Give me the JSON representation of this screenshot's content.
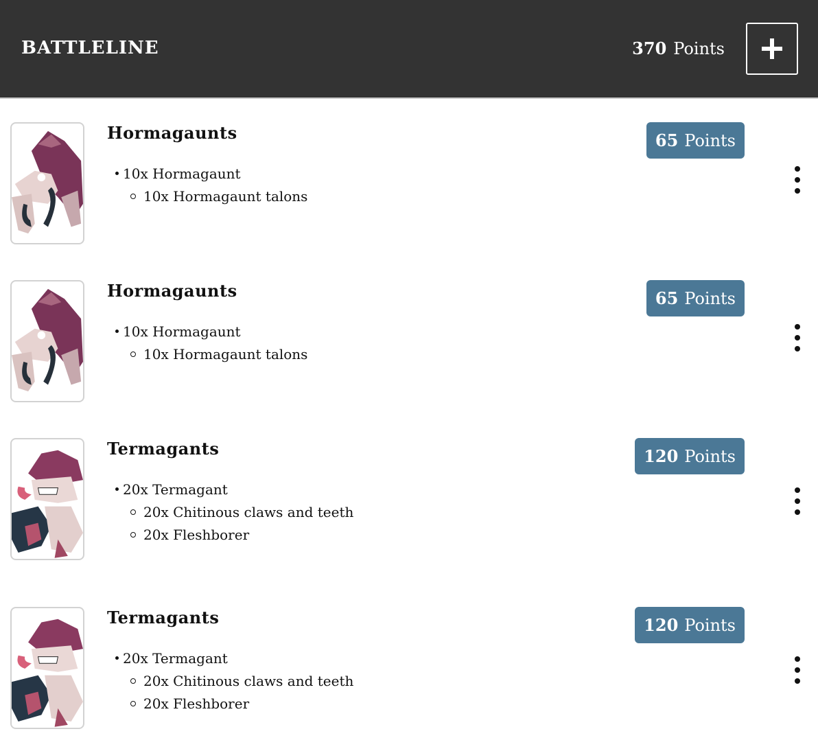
{
  "header": {
    "title": "BATTLELINE",
    "points_value": "370",
    "points_label": "Points",
    "add_icon": "plus-icon",
    "background": "#333333"
  },
  "units": [
    {
      "name": "Hormagaunts",
      "points_value": "65",
      "points_label": "Points",
      "model_line": "10x Hormagaunt",
      "weapons": [
        "10x Hormagaunt talons"
      ]
    },
    {
      "name": "Hormagaunts",
      "points_value": "65",
      "points_label": "Points",
      "model_line": "10x Hormagaunt",
      "weapons": [
        "10x Hormagaunt talons"
      ]
    },
    {
      "name": "Termagants",
      "points_value": "120",
      "points_label": "Points",
      "model_line": "20x Termagant",
      "weapons": [
        "20x Chitinous claws and teeth",
        "20x Fleshborer"
      ]
    },
    {
      "name": "Termagants",
      "points_value": "120",
      "points_label": "Points",
      "model_line": "20x Termagant",
      "weapons": [
        "20x Chitinous claws and teeth",
        "20x Fleshborer"
      ]
    }
  ],
  "colors": {
    "badge": "#4b7896",
    "thumb_border": "#d2d2d2"
  },
  "icons": {
    "menu": "more-vertical-icon",
    "thumbnail": "unit-miniature-image"
  }
}
